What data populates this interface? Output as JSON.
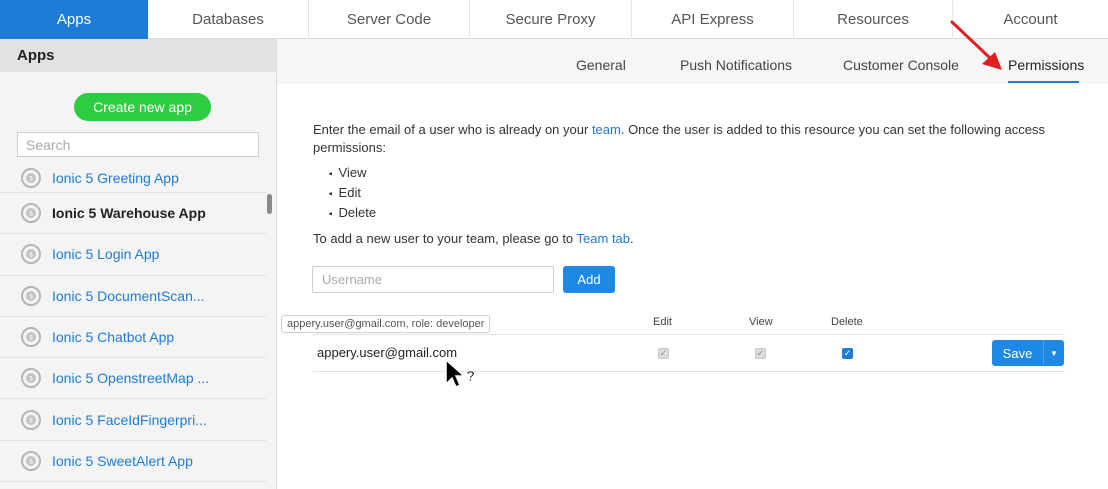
{
  "topnav": {
    "tabs": [
      {
        "label": "Apps",
        "active": true
      },
      {
        "label": "Databases"
      },
      {
        "label": "Server Code"
      },
      {
        "label": "Secure Proxy"
      },
      {
        "label": "API Express"
      },
      {
        "label": "Resources"
      },
      {
        "label": "Account"
      }
    ],
    "accent": "#1e7bd6"
  },
  "sidebar": {
    "title": "Apps",
    "create_label": "Create new app",
    "search_placeholder": "Search",
    "items": [
      {
        "label": "Ionic 5 Greeting App"
      },
      {
        "label": "Ionic 5 Warehouse App",
        "selected": true
      },
      {
        "label": "Ionic 5 Login App"
      },
      {
        "label": "Ionic 5 DocumentScan..."
      },
      {
        "label": "Ionic 5 Chatbot App"
      },
      {
        "label": "Ionic 5 OpenstreetMap ..."
      },
      {
        "label": "Ionic 5 FaceIdFingerpri..."
      },
      {
        "label": "Ionic 5 SweetAlert App"
      }
    ],
    "item_icon": "ionic-app-icon"
  },
  "subnav": {
    "tabs": [
      "General",
      "Push Notifications",
      "Customer Console",
      "Permissions"
    ],
    "active": "Permissions"
  },
  "permissions": {
    "desc_before_link": "Enter the email of a user who is already on your ",
    "desc_link": "team",
    "desc_after_link": ". Once the user is added to this resource you can set the following access permissions:",
    "list": [
      "View",
      "Edit",
      "Delete"
    ],
    "team_before_link": "To add a new user to your team, please go to ",
    "team_link": "Team tab",
    "team_after_link": ".",
    "username_placeholder": "Username",
    "add_label": "Add",
    "tooltip": "appery.user@gmail.com, role: developer",
    "columns": {
      "edit": "Edit",
      "view": "View",
      "delete": "Delete"
    },
    "user_row": {
      "email": "appery.user@gmail.com",
      "edit_checked": true,
      "view_checked": true,
      "delete_checked": true
    },
    "save_label": "Save"
  },
  "colors": {
    "active_tab": "#1e7bd6",
    "create_button": "#2ecc40",
    "primary_button": "#1e88e5",
    "annotation_arrow": "#e02020"
  }
}
